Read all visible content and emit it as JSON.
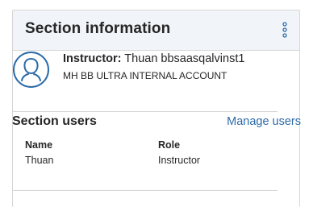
{
  "panel": {
    "title": "Section information",
    "menu_icon": "kebab-menu-icon"
  },
  "instructor": {
    "avatar_icon": "user-avatar-icon",
    "label": "Instructor:",
    "name": "Thuan bbsaasqalvinst1",
    "account": "MH BB ULTRA INTERNAL ACCOUNT"
  },
  "section_users": {
    "title": "Section users",
    "manage_label": "Manage users",
    "columns": [
      "Name",
      "Role"
    ],
    "rows": [
      {
        "name": "Thuan",
        "role": "Instructor"
      }
    ]
  },
  "colors": {
    "header_bg": "#f1f4f8",
    "accent": "#2c6ba8",
    "border": "#d6d6d6",
    "text": "#262626"
  }
}
